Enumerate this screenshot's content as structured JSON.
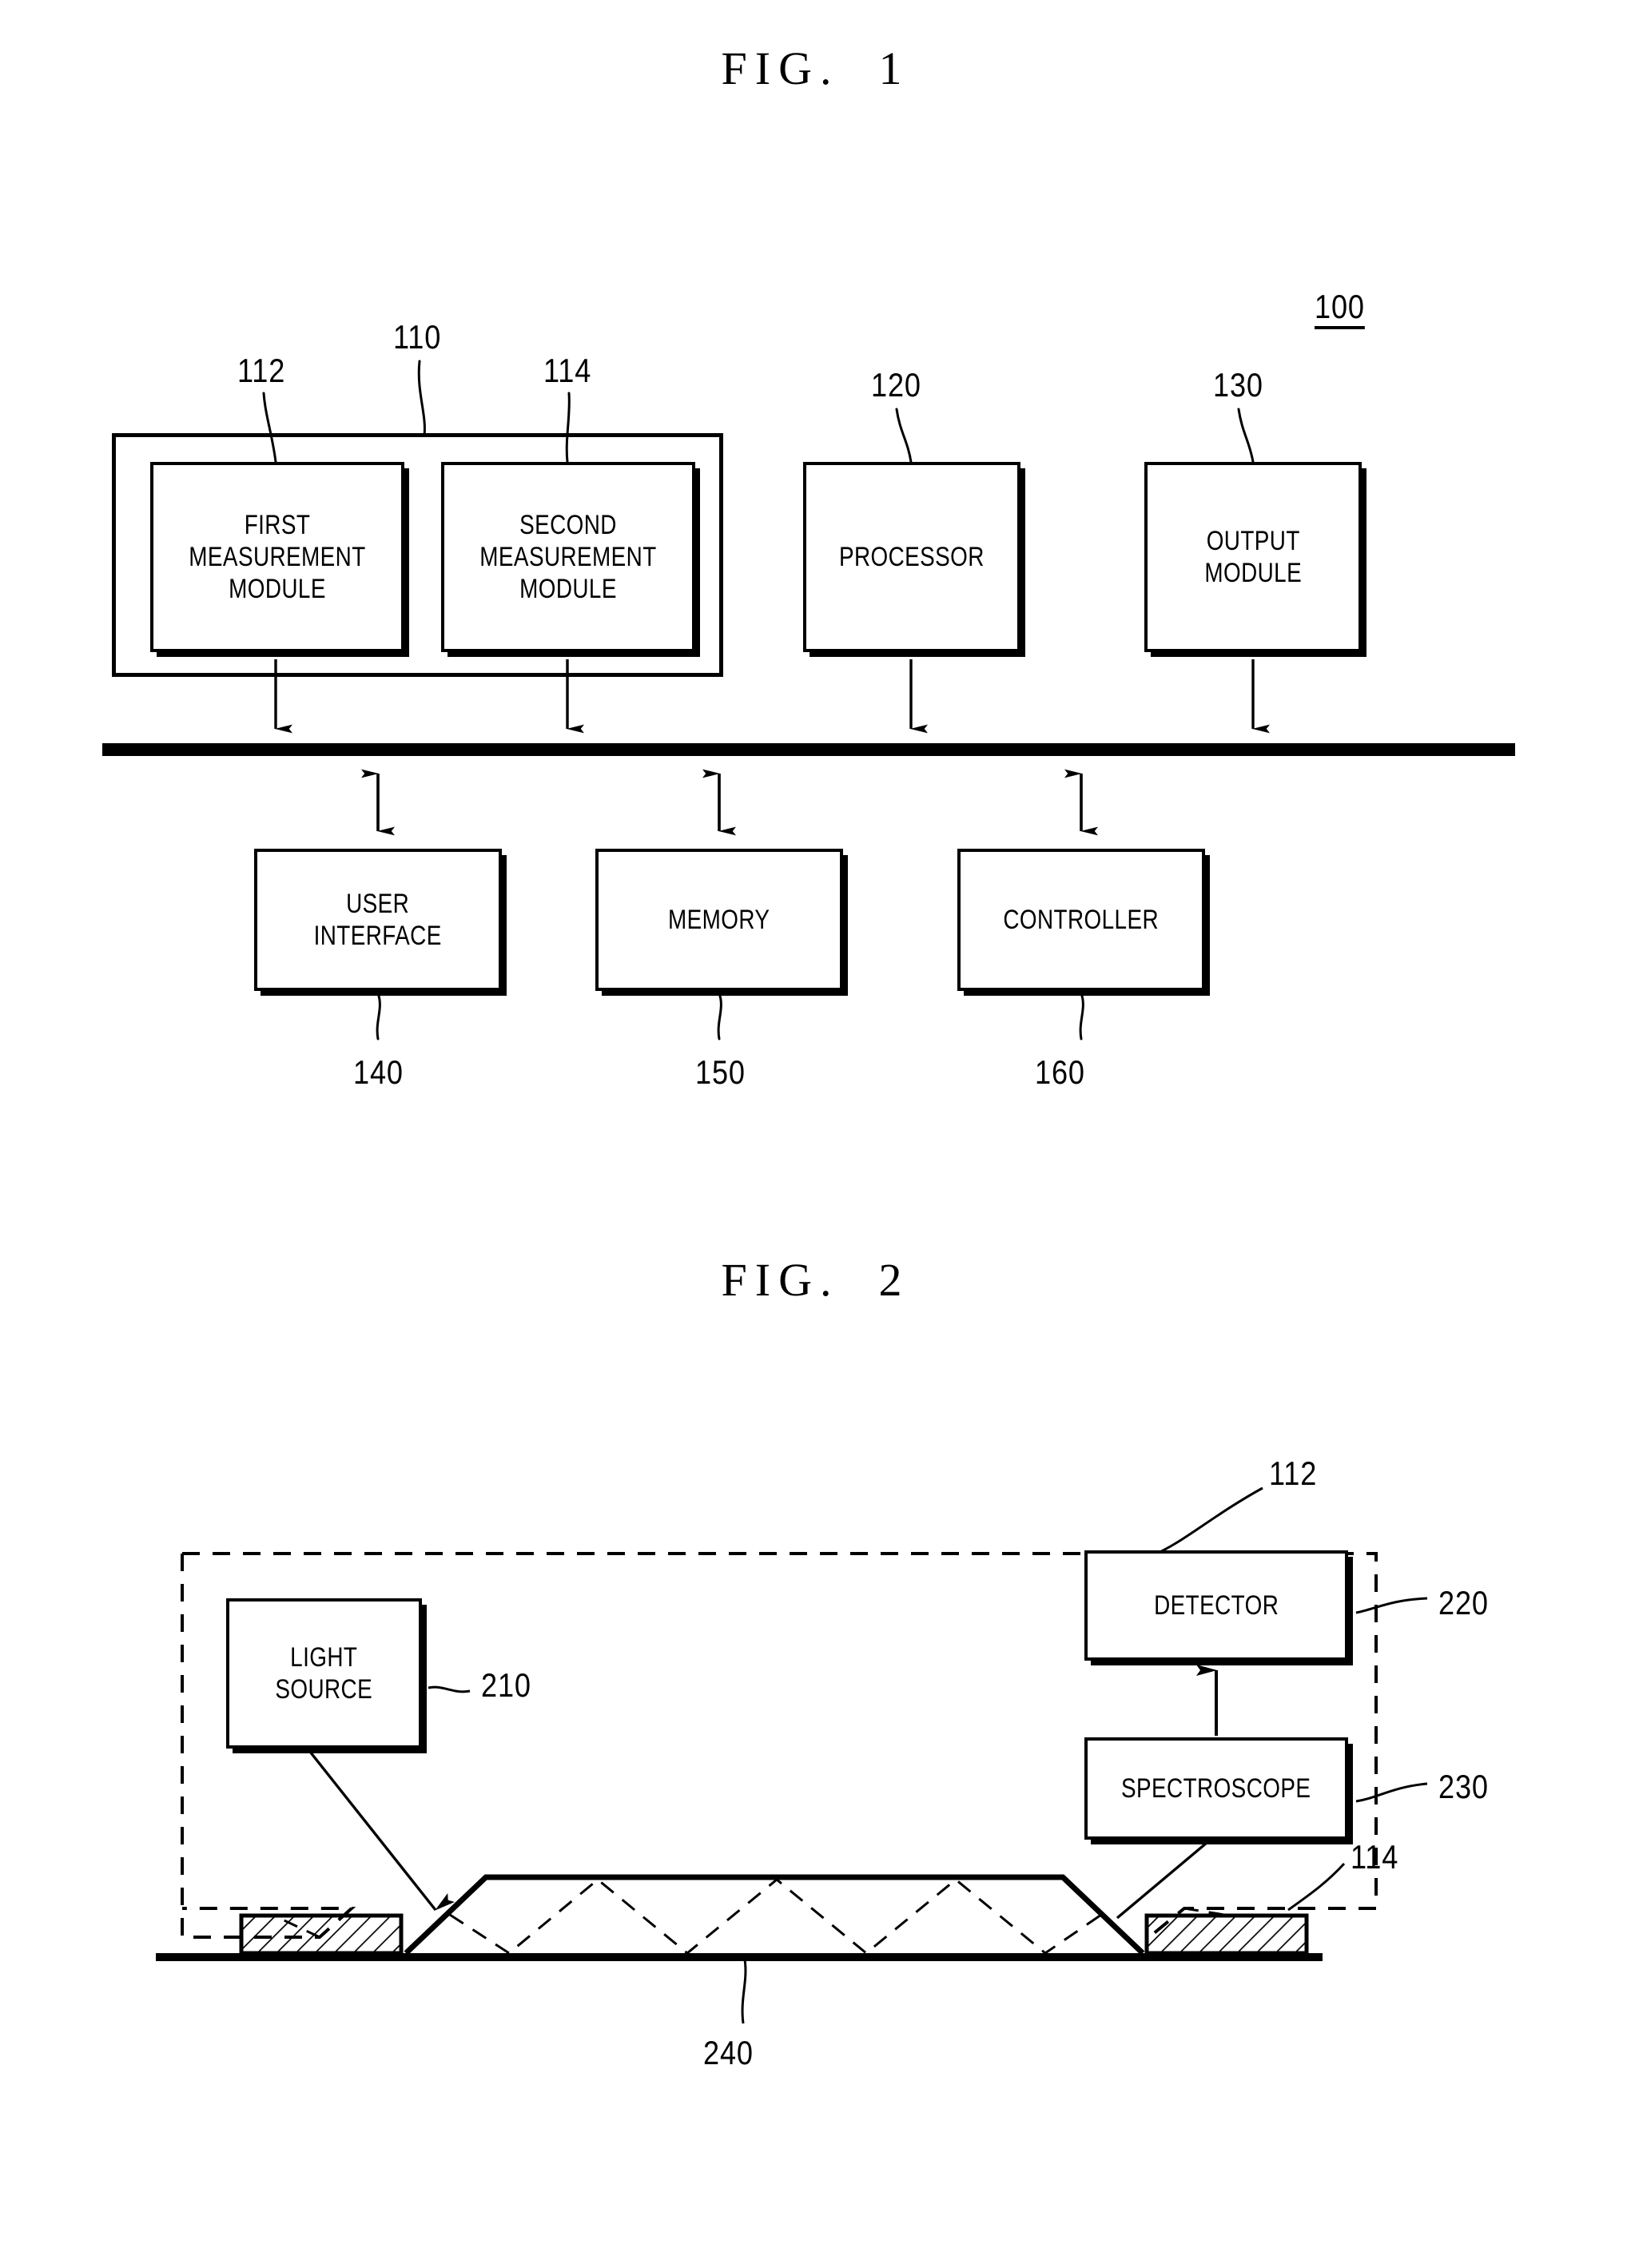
{
  "figures": [
    {
      "title": "FIG.  1",
      "system_ref": "100",
      "boxes": [
        {
          "id": "first-measurement-module",
          "label": "FIRST\nMEASUREMENT\nMODULE",
          "ref": "112"
        },
        {
          "id": "second-measurement-module",
          "label": "SECOND\nMEASUREMENT\nMODULE",
          "ref": "114"
        },
        {
          "id": "measurement-group",
          "label": "",
          "ref": "110"
        },
        {
          "id": "processor",
          "label": "PROCESSOR",
          "ref": "120"
        },
        {
          "id": "output-module",
          "label": "OUTPUT\nMODULE",
          "ref": "130"
        },
        {
          "id": "user-interface",
          "label": "USER\nINTERFACE",
          "ref": "140"
        },
        {
          "id": "memory",
          "label": "MEMORY",
          "ref": "150"
        },
        {
          "id": "controller",
          "label": "CONTROLLER",
          "ref": "160"
        }
      ]
    },
    {
      "title": "FIG.  2",
      "module_ref": "112",
      "boxes": [
        {
          "id": "light-source",
          "label": "LIGHT\nSOURCE",
          "ref": "210"
        },
        {
          "id": "detector",
          "label": "DETECTOR",
          "ref": "220"
        },
        {
          "id": "spectroscope",
          "label": "SPECTROSCOPE",
          "ref": "230"
        }
      ],
      "other_refs": [
        {
          "id": "waveguide",
          "ref": "240"
        },
        {
          "id": "second-measurement-module-electrode",
          "ref": "114"
        }
      ]
    }
  ],
  "fig1": {
    "title": "FIG.  1",
    "system_ref": "100",
    "first_measurement_module": "FIRST\nMEASUREMENT\nMODULE",
    "second_measurement_module": "SECOND\nMEASUREMENT\nMODULE",
    "processor": "PROCESSOR",
    "output_module": "OUTPUT\nMODULE",
    "user_interface": "USER\nINTERFACE",
    "memory": "MEMORY",
    "controller": "CONTROLLER",
    "ref_110": "110",
    "ref_112": "112",
    "ref_114": "114",
    "ref_120": "120",
    "ref_130": "130",
    "ref_140": "140",
    "ref_150": "150",
    "ref_160": "160"
  },
  "fig2": {
    "title": "FIG.  2",
    "light_source": "LIGHT\nSOURCE",
    "detector": "DETECTOR",
    "spectroscope": "SPECTROSCOPE",
    "ref_112": "112",
    "ref_114": "114",
    "ref_210": "210",
    "ref_220": "220",
    "ref_230": "230",
    "ref_240": "240"
  },
  "colors": {
    "ink": "#000000",
    "paper": "#ffffff"
  }
}
